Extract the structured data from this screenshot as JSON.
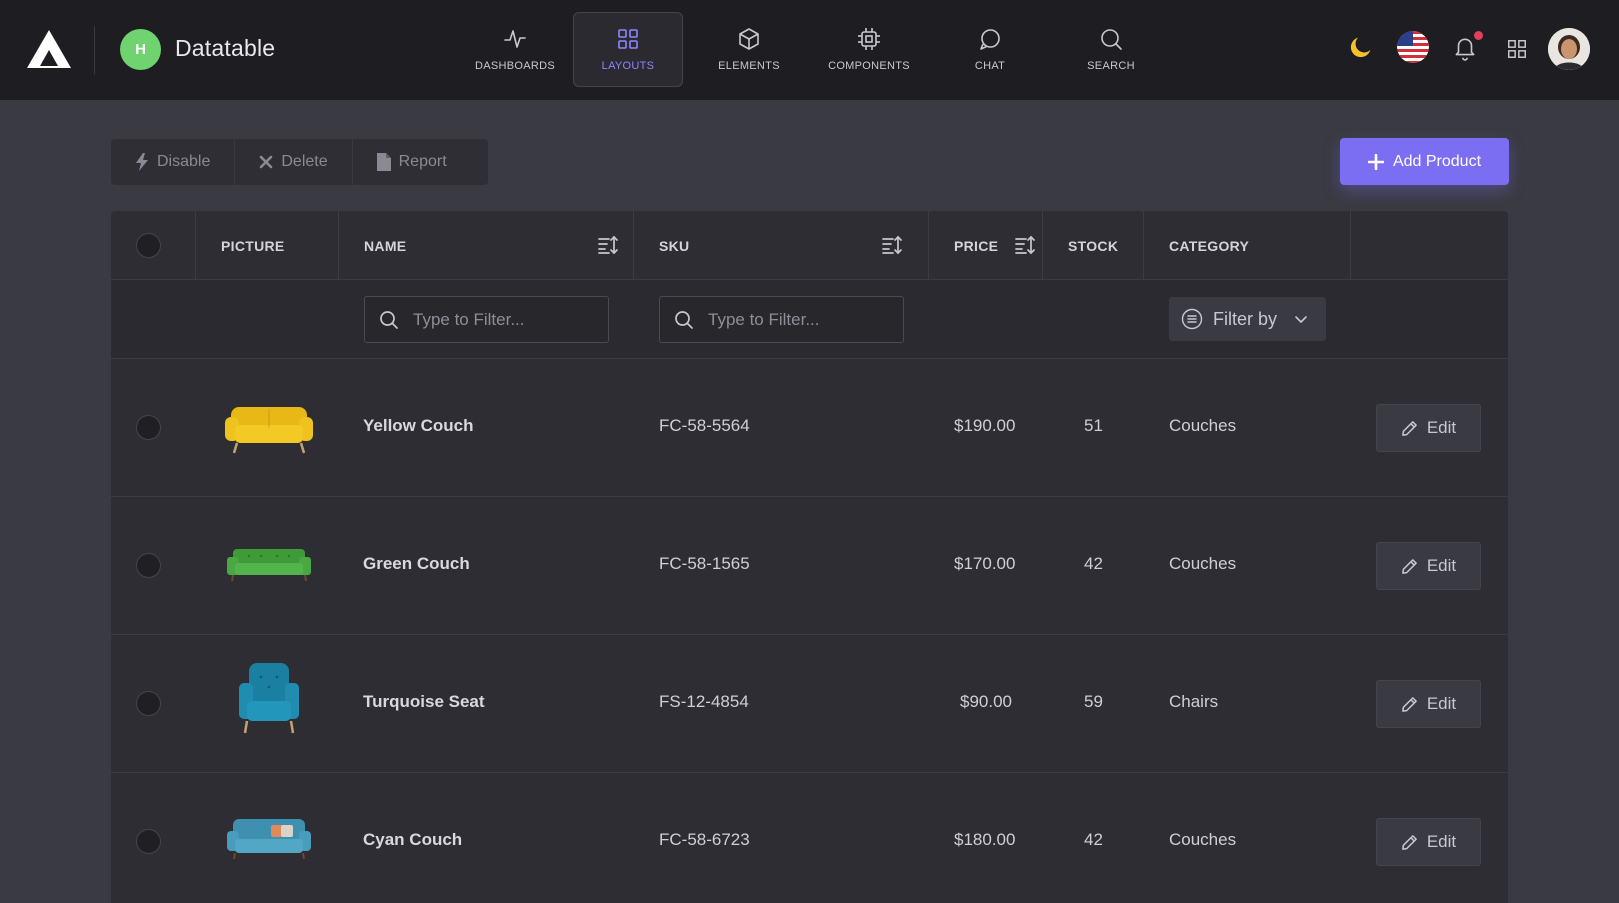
{
  "app": {
    "title": "Datatable",
    "avatar_initial": "H"
  },
  "nav": [
    {
      "label": "DASHBOARDS",
      "icon": "activity-icon",
      "active": false
    },
    {
      "label": "LAYOUTS",
      "icon": "grid-icon",
      "active": true
    },
    {
      "label": "ELEMENTS",
      "icon": "box-icon",
      "active": false
    },
    {
      "label": "COMPONENTS",
      "icon": "cpu-icon",
      "active": false
    },
    {
      "label": "CHAT",
      "icon": "chat-icon",
      "active": false
    },
    {
      "label": "SEARCH",
      "icon": "search-icon",
      "active": false
    }
  ],
  "toolbar": {
    "disable_label": "Disable",
    "delete_label": "Delete",
    "report_label": "Report",
    "add_label": "Add Product"
  },
  "table": {
    "headers": {
      "picture": "PICTURE",
      "name": "NAME",
      "sku": "SKU",
      "price": "PRICE",
      "stock": "STOCK",
      "category": "CATEGORY"
    },
    "filters": {
      "name_placeholder": "Type to Filter...",
      "sku_placeholder": "Type to Filter...",
      "category_select": "Filter by"
    },
    "rows": [
      {
        "name": "Yellow Couch",
        "sku": "FC-58-5564",
        "price": "$190.00",
        "stock": "51",
        "category": "Couches",
        "edit": "Edit",
        "color": "#f0c21e"
      },
      {
        "name": "Green Couch",
        "sku": "FC-58-1565",
        "price": "$170.00",
        "stock": "42",
        "category": "Couches",
        "edit": "Edit",
        "color": "#4aa843"
      },
      {
        "name": "Turquoise Seat",
        "sku": "FS-12-4854",
        "price": "$90.00",
        "stock": "59",
        "category": "Chairs",
        "edit": "Edit",
        "color": "#1a7fa0"
      },
      {
        "name": "Cyan Couch",
        "sku": "FC-58-6723",
        "price": "$180.00",
        "stock": "42",
        "category": "Couches",
        "edit": "Edit",
        "color": "#3f8fb0"
      }
    ]
  },
  "colors": {
    "accent": "#7c6ef2",
    "topbar": "#1e1e22",
    "background": "#3a3a42",
    "table": "#2d2d33"
  }
}
